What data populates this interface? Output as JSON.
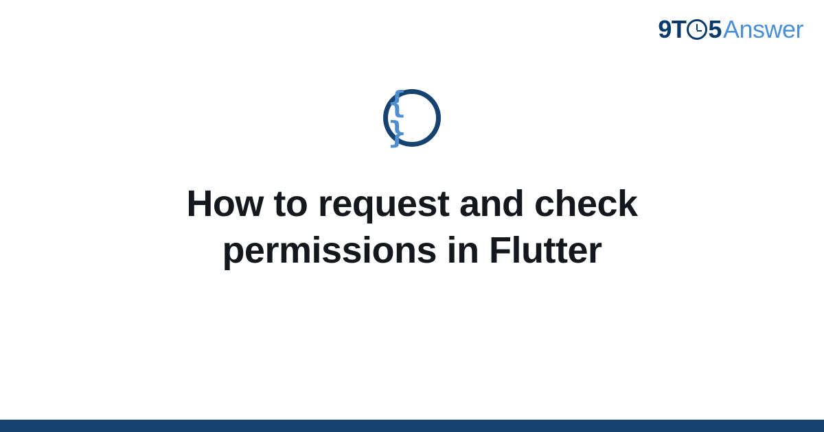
{
  "brand": {
    "part1": "9",
    "part2": "T",
    "part3": "5",
    "part4": "Answer",
    "clock_icon_name": "clock-icon"
  },
  "badge": {
    "glyph": "{ }",
    "icon_name": "braces-icon",
    "ring_color": "#16426f",
    "glyph_color": "#4e8ecf"
  },
  "main": {
    "title": "How to request and check permissions in Flutter"
  },
  "colors": {
    "brand_dark": "#0a3a6b",
    "brand_light": "#4a8fd8",
    "text": "#14181d",
    "footer": "#16426f"
  }
}
